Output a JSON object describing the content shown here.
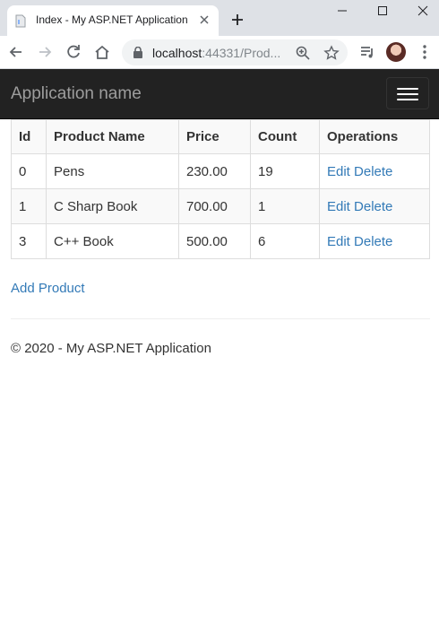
{
  "browser": {
    "tab_title": "Index - My ASP.NET Application",
    "url_host": "localhost",
    "url_rest": ":44331/Prod..."
  },
  "navbar": {
    "brand": "Application name"
  },
  "table": {
    "headers": [
      "Id",
      "Product Name",
      "Price",
      "Count",
      "Operations"
    ],
    "rows": [
      {
        "id": "0",
        "name": "Pens",
        "price": "230.00",
        "count": "19",
        "edit": "Edit",
        "delete": "Delete"
      },
      {
        "id": "1",
        "name": "C Sharp Book",
        "price": "700.00",
        "count": "1",
        "edit": "Edit",
        "delete": "Delete"
      },
      {
        "id": "3",
        "name": "C++ Book",
        "price": "500.00",
        "count": "6",
        "edit": "Edit",
        "delete": "Delete"
      }
    ]
  },
  "actions": {
    "add_product": "Add Product"
  },
  "footer": {
    "text": "© 2020 - My ASP.NET Application"
  },
  "colors": {
    "navbar_bg": "#222222",
    "brand_text": "#9d9d9d",
    "link": "#337ab7"
  }
}
